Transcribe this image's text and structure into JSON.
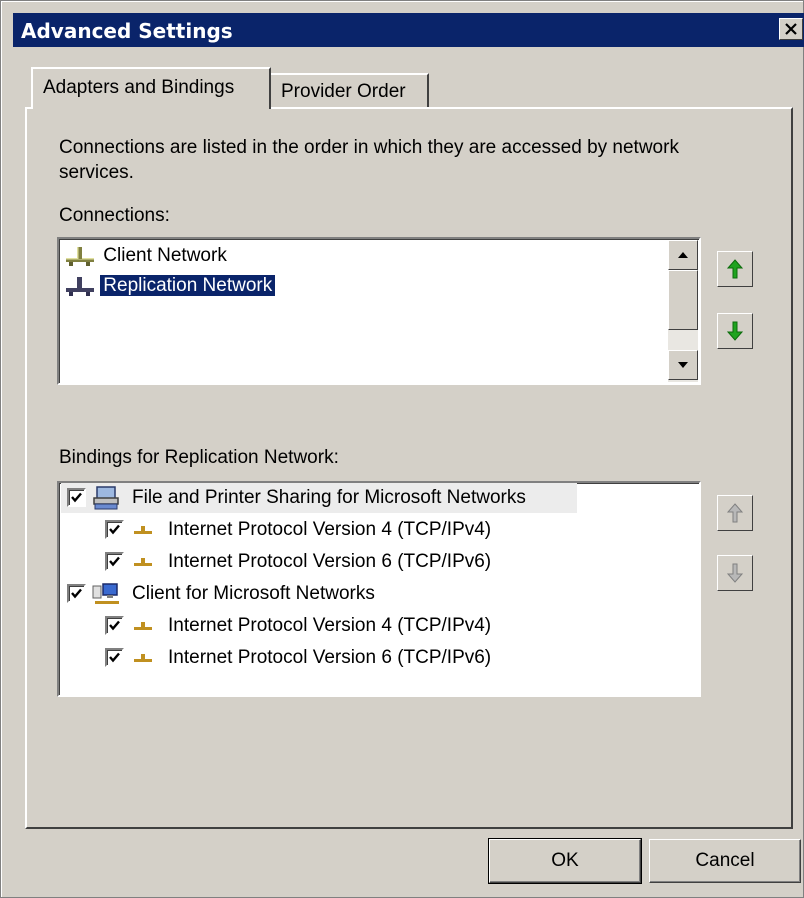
{
  "window": {
    "title": "Advanced Settings"
  },
  "tabs": [
    {
      "label": "Adapters and Bindings",
      "active": true
    },
    {
      "label": "Provider Order",
      "active": false
    }
  ],
  "description": "Connections are listed in the order in which they are accessed by network services.",
  "connections": {
    "label": "Connections:",
    "items": [
      {
        "label": "Client Network",
        "selected": false
      },
      {
        "label": "Replication Network",
        "selected": true
      }
    ]
  },
  "bindings": {
    "label": "Bindings for Replication Network:",
    "items": [
      {
        "label": "File and Printer Sharing for Microsoft Networks",
        "level": 0,
        "checked": true,
        "icon": "printer-sharing-icon"
      },
      {
        "label": "Internet Protocol Version 4 (TCP/IPv4)",
        "level": 1,
        "checked": true,
        "icon": "protocol-icon"
      },
      {
        "label": "Internet Protocol Version 6 (TCP/IPv6)",
        "level": 1,
        "checked": true,
        "icon": "protocol-icon"
      },
      {
        "label": "Client for Microsoft Networks",
        "level": 0,
        "checked": true,
        "icon": "network-client-icon"
      },
      {
        "label": "Internet Protocol Version 4 (TCP/IPv4)",
        "level": 1,
        "checked": true,
        "icon": "protocol-icon"
      },
      {
        "label": "Internet Protocol Version 6 (TCP/IPv6)",
        "level": 1,
        "checked": true,
        "icon": "protocol-icon"
      }
    ]
  },
  "buttons": {
    "ok": "OK",
    "cancel": "Cancel"
  },
  "colors": {
    "titlebar": "#0a246a",
    "selection": "#0a246a",
    "arrow_enabled": "#1fa31f",
    "arrow_disabled": "#9a9a9a",
    "face": "#d4d0c8"
  }
}
